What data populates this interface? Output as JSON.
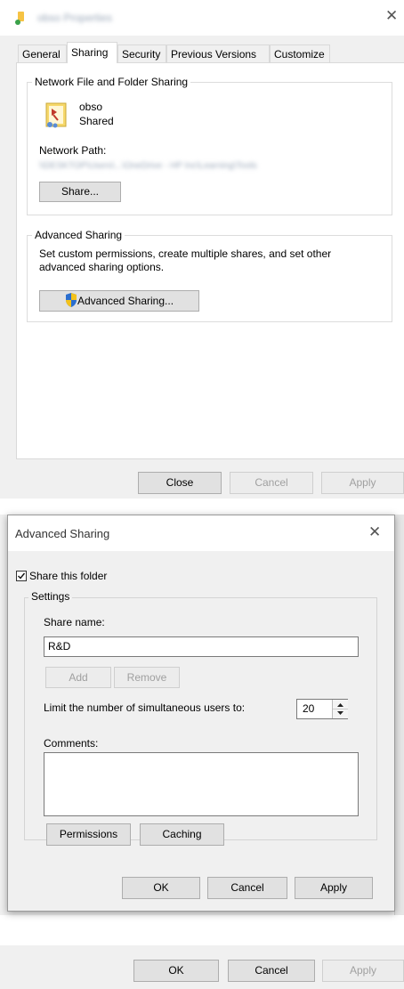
{
  "props": {
    "title": "obso Properties",
    "tabs": [
      {
        "label": "General"
      },
      {
        "label": "Sharing"
      },
      {
        "label": "Security"
      },
      {
        "label": "Previous Versions"
      },
      {
        "label": "Customize"
      }
    ],
    "network_group": {
      "label": "Network File and Folder Sharing",
      "folder_name": "obso",
      "status": "Shared",
      "network_path_label": "Network Path:",
      "network_path_value": "\\\\DESKTOP\\Users\\...\\OneDrive - HP Inc\\Learning\\Tools",
      "share_button": "Share..."
    },
    "advanced_group": {
      "label": "Advanced Sharing",
      "description": "Set custom permissions, create multiple shares, and set other advanced sharing options.",
      "button": "Advanced Sharing..."
    },
    "buttons": {
      "close": "Close",
      "cancel": "Cancel",
      "apply": "Apply"
    }
  },
  "advanced_dialog": {
    "title": "Advanced Sharing",
    "share_checkbox_label": "Share this folder",
    "share_checked": true,
    "settings_label": "Settings",
    "share_name_label": "Share name:",
    "share_name_value": "R&D",
    "add_button": "Add",
    "remove_button": "Remove",
    "limit_label": "Limit the number of simultaneous users to:",
    "limit_value": "20",
    "comments_label": "Comments:",
    "comments_value": "",
    "permissions_button": "Permissions",
    "caching_button": "Caching",
    "ok_button": "OK",
    "cancel_button": "Cancel",
    "apply_button": "Apply"
  },
  "bottom_bar": {
    "ok": "OK",
    "cancel": "Cancel",
    "apply": "Apply"
  },
  "colors": {
    "shield_blue": "#2a6ecf",
    "shield_yellow": "#f4c21b",
    "folder_yellow": "#f6c344",
    "folder_green": "#3aa14a"
  }
}
